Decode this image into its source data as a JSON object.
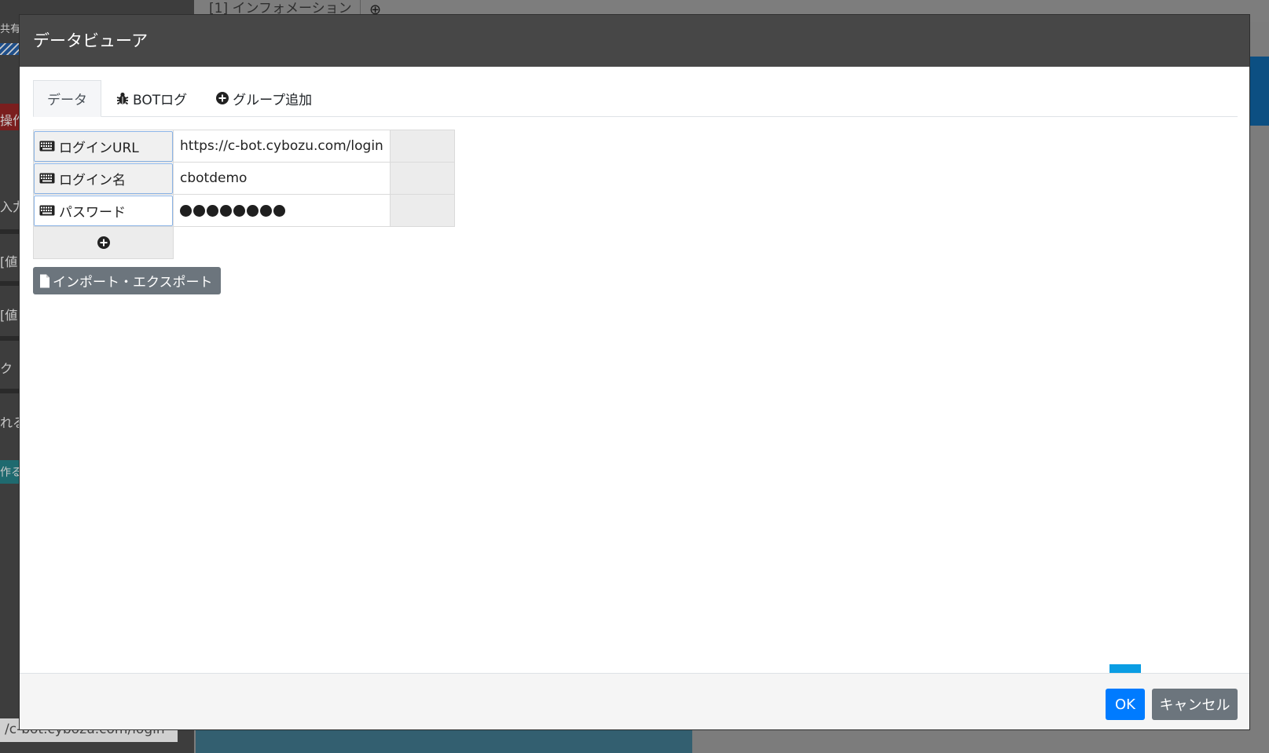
{
  "background": {
    "tab_label": "[1] インフォメーション",
    "side_texts": [
      "共有",
      "操作",
      "入力",
      "[値",
      "[値",
      "ク",
      "れる",
      "作る"
    ],
    "url_fragment": "/c-bot.cybozu.com/login"
  },
  "modal": {
    "title": "データビューア",
    "tabs": [
      {
        "label": "データ",
        "icon": "none",
        "active": true
      },
      {
        "label": "BOTログ",
        "icon": "bug-icon",
        "active": false
      },
      {
        "label": "グループ追加",
        "icon": "plus-circle-icon",
        "active": false
      }
    ],
    "rows": [
      {
        "key": "ログインURL",
        "value": "https://c-bot.cybozu.com/login",
        "icon": "keyboard-icon"
      },
      {
        "key": "ログイン名",
        "value": "cbotdemo",
        "icon": "keyboard-icon"
      },
      {
        "key": "パスワード",
        "value": "●●●●●●●●",
        "masked": true,
        "dot_count": 8,
        "icon": "keyboard-icon"
      }
    ],
    "add_row_icon": "plus-circle-icon",
    "import_export_label": "インポート・エクスポート",
    "import_export_icon": "file-icon",
    "ok_label": "OK",
    "cancel_label": "キャンセル",
    "annotation_arrow_color": "#0a9de3"
  },
  "colors": {
    "header_bg": "#474747",
    "primary": "#007bff",
    "secondary": "#6c757d"
  }
}
